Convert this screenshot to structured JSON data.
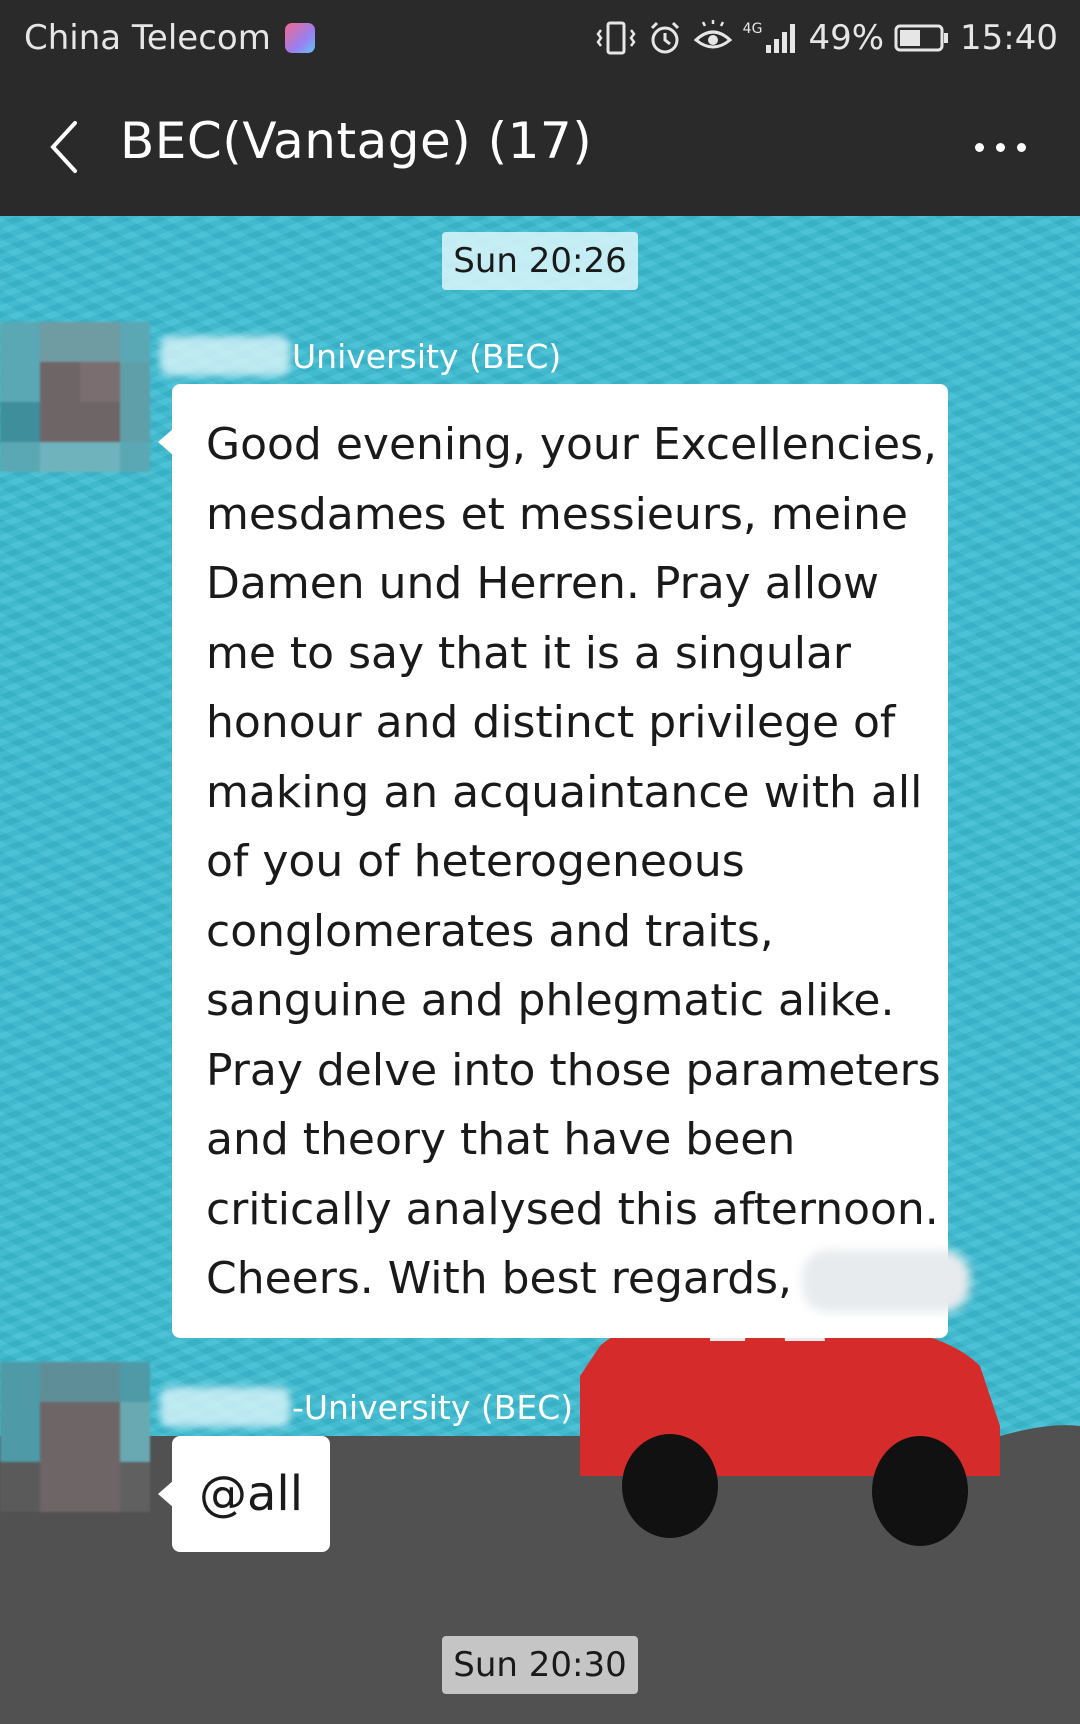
{
  "status_bar": {
    "carrier": "China Telecom",
    "network": "4G",
    "battery": "49%",
    "time": "15:40"
  },
  "nav": {
    "title": "BEC(Vantage) (17)"
  },
  "chat": {
    "timestamps": [
      "Sun 20:26",
      "Sun 20:30"
    ],
    "messages": [
      {
        "sender": "University (BEC)",
        "lines": [
          "Good evening, your Excellencies,",
          "mesdames et messieurs, meine",
          "Damen und Herren. Pray allow",
          "me to say that it is a singular",
          "honour and distinct privilege of",
          "making an acquaintance with all",
          "of you of heterogeneous",
          "conglomerates and traits,",
          "sanguine and phlegmatic alike.",
          "Pray delve into those parameters",
          "and theory that have been",
          "critically analysed this afternoon.",
          "Cheers. With best regards,"
        ]
      },
      {
        "sender": "-University (BEC)",
        "text": "@all"
      }
    ]
  },
  "icons": [
    "vibrate-icon",
    "alarm-icon",
    "eye-icon",
    "signal-icon",
    "battery-icon",
    "back-icon",
    "more-icon"
  ],
  "colors": {
    "bar_bg": "#2a2a2a",
    "chat_bg": "#3cbcd2",
    "bubble_bg": "#ffffff",
    "car_red": "#d62b2b"
  }
}
